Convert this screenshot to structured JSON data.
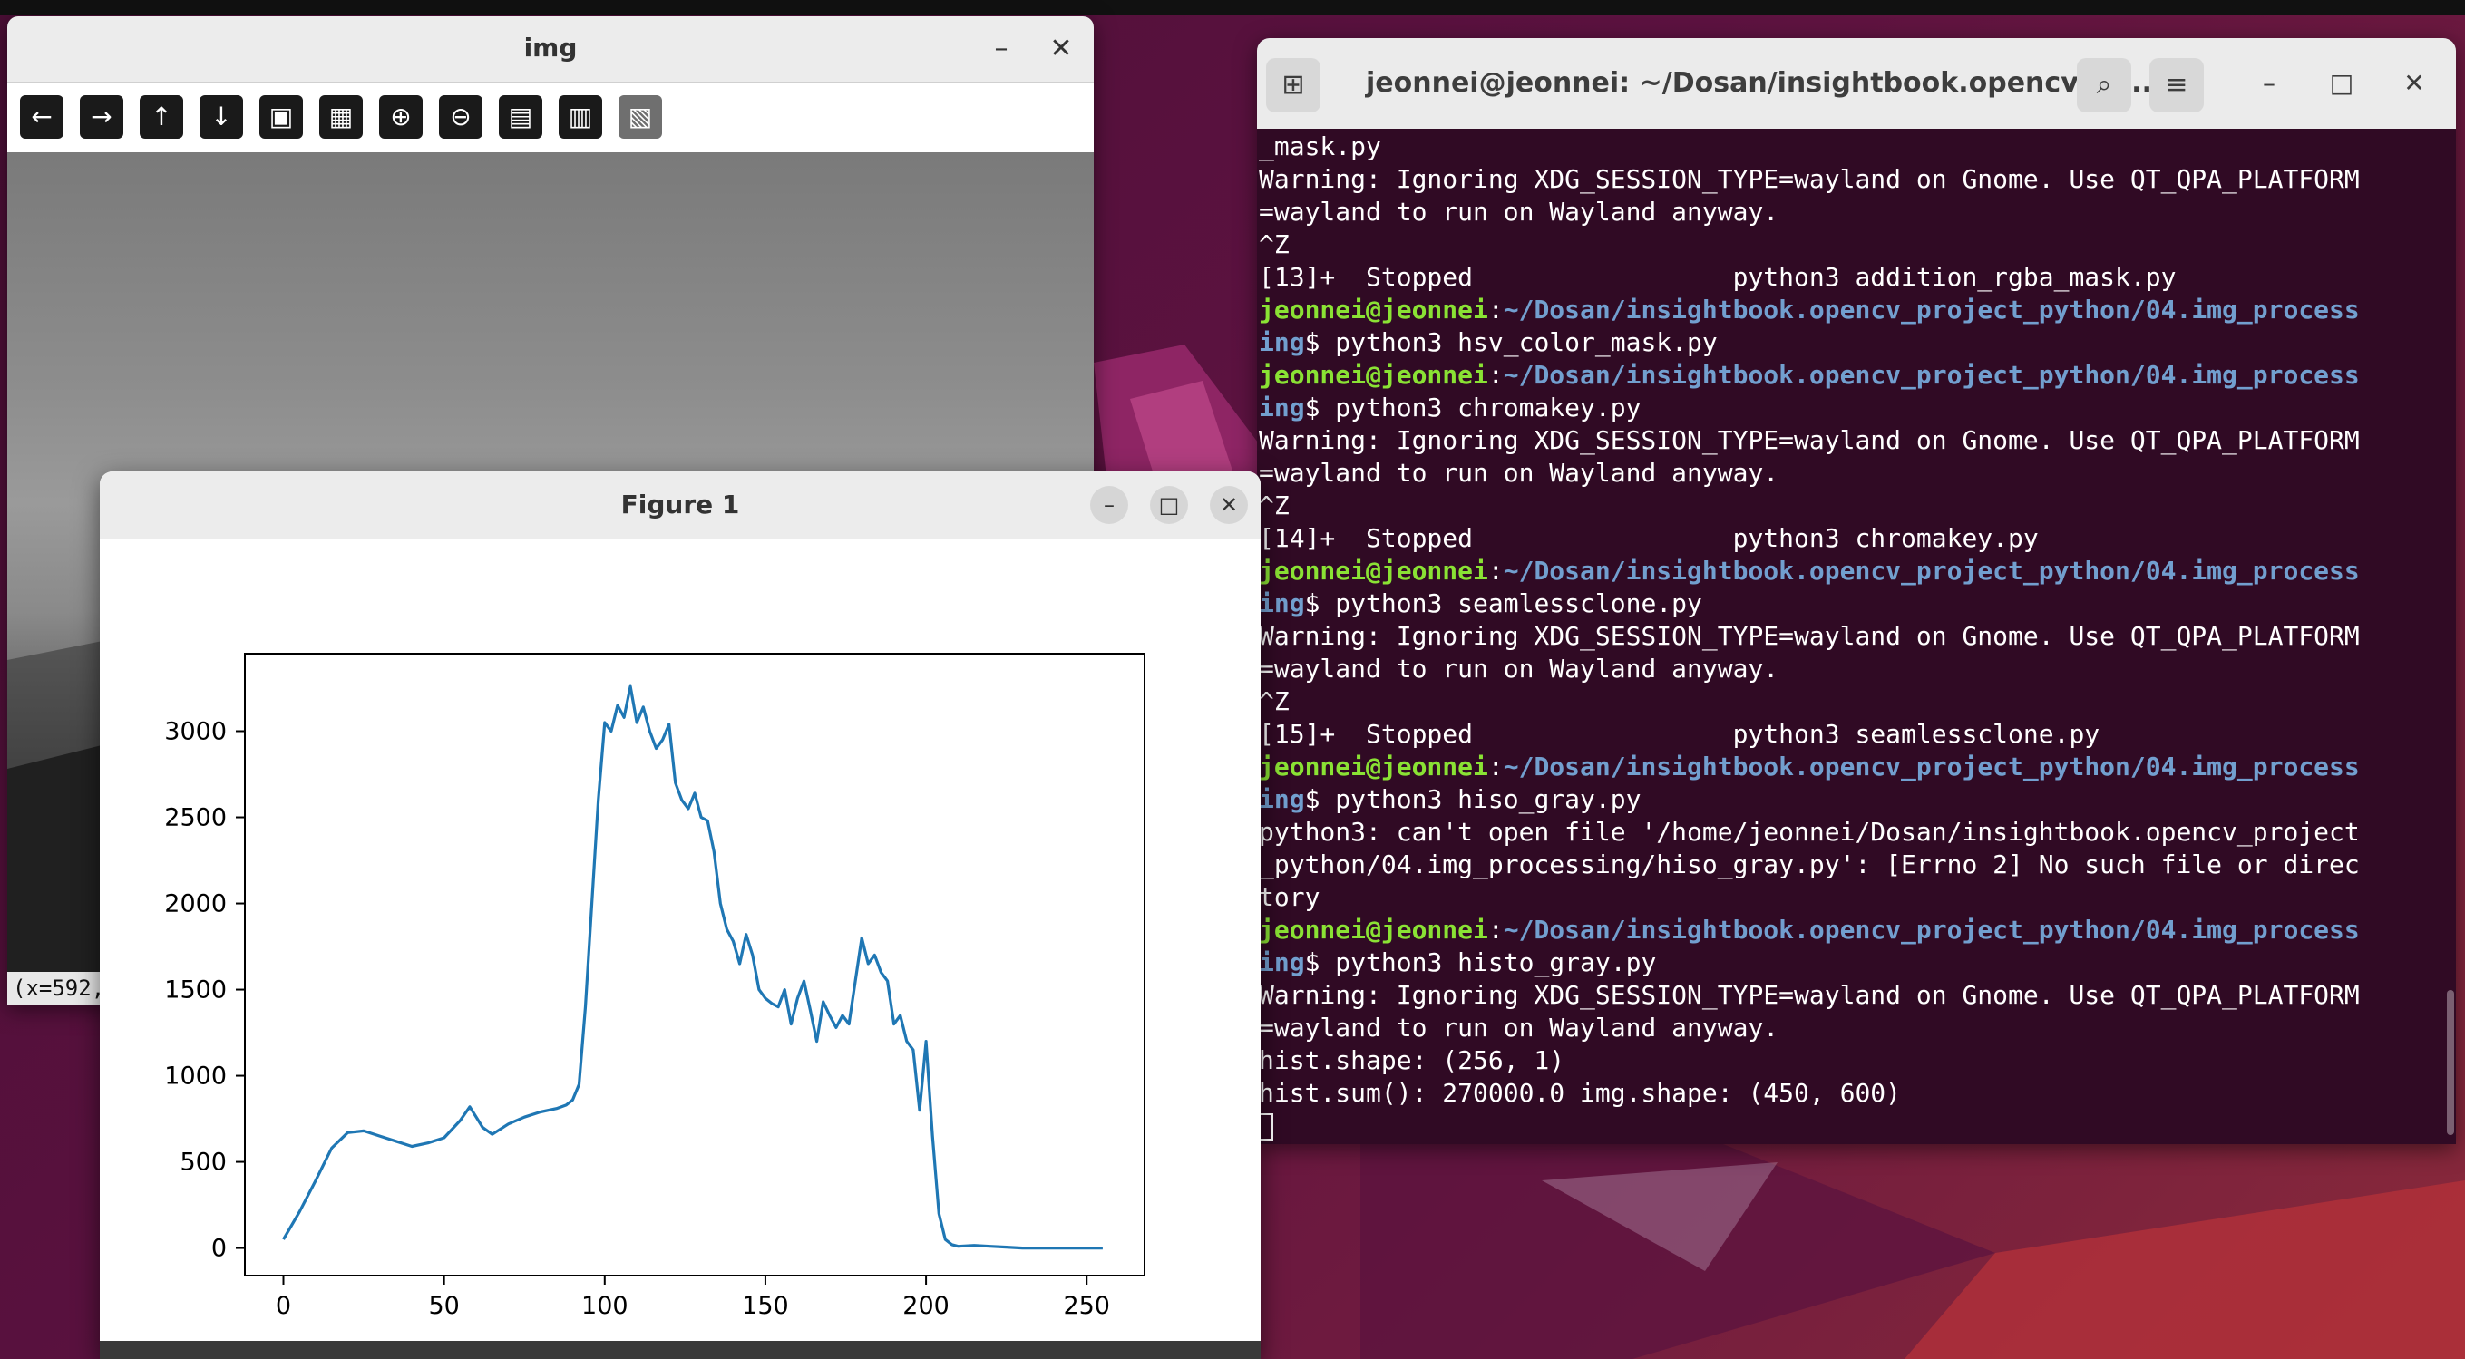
{
  "img_window": {
    "title": "img",
    "minimize": "–",
    "close": "✕",
    "toolbar": [
      {
        "name": "pan-left-icon",
        "glyph": "←"
      },
      {
        "name": "pan-right-icon",
        "glyph": "→"
      },
      {
        "name": "pan-up-icon",
        "glyph": "↑"
      },
      {
        "name": "pan-down-icon",
        "glyph": "↓"
      },
      {
        "name": "zoom-fit-icon",
        "glyph": "▣"
      },
      {
        "name": "zoom-original-icon",
        "glyph": "▦"
      },
      {
        "name": "zoom-in-icon",
        "glyph": "⊕"
      },
      {
        "name": "zoom-out-icon",
        "glyph": "⊖"
      },
      {
        "name": "save-icon",
        "glyph": "▤"
      },
      {
        "name": "copy-clipboard-icon",
        "glyph": "▥"
      },
      {
        "name": "properties-icon",
        "glyph": "▧"
      }
    ],
    "status": "(x=592,"
  },
  "figure_window": {
    "title": "Figure 1",
    "minimize": "–",
    "maximize": "□",
    "close": "✕"
  },
  "chart_data": {
    "type": "line",
    "title": "",
    "xlabel": "",
    "ylabel": "",
    "xlim": [
      -12,
      268
    ],
    "ylim": [
      -160,
      3450
    ],
    "xticks": [
      0,
      50,
      100,
      150,
      200,
      250
    ],
    "yticks": [
      0,
      500,
      1000,
      1500,
      2000,
      2500,
      3000
    ],
    "color": "#1f77b4",
    "series": [
      {
        "x": [
          0,
          5,
          10,
          15,
          20,
          25,
          30,
          35,
          40,
          45,
          50,
          55,
          58,
          60,
          62,
          65,
          70,
          75,
          80,
          85,
          88,
          90,
          92,
          94,
          96,
          98,
          100,
          102,
          104,
          106,
          108,
          110,
          112,
          114,
          116,
          118,
          120,
          122,
          124,
          126,
          128,
          130,
          132,
          134,
          136,
          138,
          140,
          142,
          144,
          146,
          148,
          150,
          152,
          154,
          156,
          158,
          160,
          162,
          164,
          166,
          168,
          170,
          172,
          174,
          176,
          178,
          180,
          182,
          184,
          186,
          188,
          190,
          192,
          194,
          196,
          198,
          200,
          202,
          204,
          206,
          208,
          210,
          215,
          220,
          225,
          230,
          240,
          250,
          255
        ],
        "y": [
          50,
          210,
          390,
          580,
          670,
          680,
          650,
          620,
          590,
          610,
          640,
          740,
          820,
          760,
          700,
          660,
          720,
          760,
          790,
          810,
          830,
          860,
          950,
          1400,
          2000,
          2600,
          3050,
          3000,
          3150,
          3080,
          3260,
          3050,
          3140,
          3000,
          2900,
          2950,
          3040,
          2700,
          2600,
          2550,
          2640,
          2500,
          2480,
          2300,
          2000,
          1850,
          1780,
          1650,
          1820,
          1700,
          1500,
          1450,
          1420,
          1400,
          1500,
          1300,
          1450,
          1550,
          1380,
          1200,
          1430,
          1350,
          1280,
          1350,
          1300,
          1550,
          1800,
          1650,
          1700,
          1600,
          1550,
          1300,
          1350,
          1200,
          1150,
          800,
          1200,
          650,
          200,
          50,
          20,
          10,
          15,
          10,
          5,
          0,
          0,
          0,
          0
        ]
      }
    ]
  },
  "terminal": {
    "title": "jeonnei@jeonnei: ~/Dosan/insightbook.opencv_pr...",
    "new_tab": "⊞",
    "search": "⌕",
    "menu": "≡",
    "minimize": "–",
    "maximize": "□",
    "close": "✕",
    "lines": [
      {
        "type": "out",
        "text": "_mask.py"
      },
      {
        "type": "out",
        "text": "Warning: Ignoring XDG_SESSION_TYPE=wayland on Gnome. Use QT_QPA_PLATFORM"
      },
      {
        "type": "out",
        "text": "=wayland to run on Wayland anyway."
      },
      {
        "type": "out",
        "text": "^Z"
      },
      {
        "type": "out",
        "text": "[13]+  Stopped                 python3 addition_rgba_mask.py"
      },
      {
        "type": "prompt",
        "user": "jeonnei@jeonnei",
        "path": "~/Dosan/insightbook.opencv_project_python/04.img_process",
        "cmd": ""
      },
      {
        "type": "prompt2",
        "path": "ing",
        "cmd": "$ python3 hsv_color_mask.py"
      },
      {
        "type": "prompt",
        "user": "jeonnei@jeonnei",
        "path": "~/Dosan/insightbook.opencv_project_python/04.img_process",
        "cmd": ""
      },
      {
        "type": "prompt2",
        "path": "ing",
        "cmd": "$ python3 chromakey.py"
      },
      {
        "type": "out",
        "text": "Warning: Ignoring XDG_SESSION_TYPE=wayland on Gnome. Use QT_QPA_PLATFORM"
      },
      {
        "type": "out",
        "text": "=wayland to run on Wayland anyway."
      },
      {
        "type": "out",
        "text": "^Z"
      },
      {
        "type": "out",
        "text": "[14]+  Stopped                 python3 chromakey.py"
      },
      {
        "type": "prompt",
        "user": "jeonnei@jeonnei",
        "path": "~/Dosan/insightbook.opencv_project_python/04.img_process",
        "cmd": ""
      },
      {
        "type": "prompt2",
        "path": "ing",
        "cmd": "$ python3 seamlessclone.py"
      },
      {
        "type": "out",
        "text": "Warning: Ignoring XDG_SESSION_TYPE=wayland on Gnome. Use QT_QPA_PLATFORM"
      },
      {
        "type": "out",
        "text": "=wayland to run on Wayland anyway."
      },
      {
        "type": "out",
        "text": "^Z"
      },
      {
        "type": "out",
        "text": "[15]+  Stopped                 python3 seamlessclone.py"
      },
      {
        "type": "prompt",
        "user": "jeonnei@jeonnei",
        "path": "~/Dosan/insightbook.opencv_project_python/04.img_process",
        "cmd": ""
      },
      {
        "type": "prompt2",
        "path": "ing",
        "cmd": "$ python3 hiso_gray.py"
      },
      {
        "type": "out",
        "text": "python3: can't open file '/home/jeonnei/Dosan/insightbook.opencv_project"
      },
      {
        "type": "out",
        "text": "_python/04.img_processing/hiso_gray.py': [Errno 2] No such file or direc"
      },
      {
        "type": "out",
        "text": "tory"
      },
      {
        "type": "prompt",
        "user": "jeonnei@jeonnei",
        "path": "~/Dosan/insightbook.opencv_project_python/04.img_process",
        "cmd": ""
      },
      {
        "type": "prompt2",
        "path": "ing",
        "cmd": "$ python3 histo_gray.py"
      },
      {
        "type": "out",
        "text": "Warning: Ignoring XDG_SESSION_TYPE=wayland on Gnome. Use QT_QPA_PLATFORM"
      },
      {
        "type": "out",
        "text": "=wayland to run on Wayland anyway."
      },
      {
        "type": "out",
        "text": "hist.shape: (256, 1)"
      },
      {
        "type": "out",
        "text": "hist.sum(): 270000.0 img.shape: (450, 600)"
      },
      {
        "type": "cursor",
        "text": ""
      }
    ]
  }
}
